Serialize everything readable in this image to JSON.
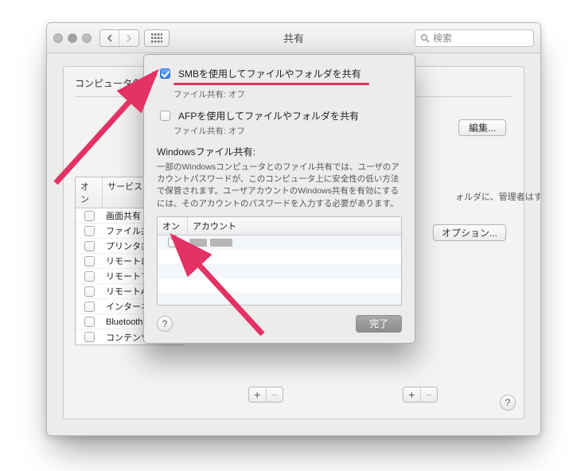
{
  "window": {
    "title": "共有",
    "search_placeholder": "検索"
  },
  "main": {
    "computer_name_label": "コンピュータ名",
    "edit_button": "編集...",
    "option_button": "オプション...",
    "right_caption": "ォルダに、管理者はす",
    "services_header_on": "オン",
    "services_header_name": "サービス",
    "services": [
      {
        "on": false,
        "label": "画面共有"
      },
      {
        "on": false,
        "label": "ファイル共有"
      },
      {
        "on": false,
        "label": "プリンタ共"
      },
      {
        "on": false,
        "label": "リモートログ"
      },
      {
        "on": false,
        "label": "リモートマネ"
      },
      {
        "on": false,
        "label": "リモートApp"
      },
      {
        "on": false,
        "label": "インターネッ"
      },
      {
        "on": false,
        "label": "Bluetooth共"
      },
      {
        "on": false,
        "label": "コンテンツキ"
      }
    ]
  },
  "sheet": {
    "smb_label": "SMBを使用してファイルやフォルダを共有",
    "smb_sub": "ファイル共有: オフ",
    "afp_label": "AFPを使用してファイルやフォルダを共有",
    "afp_sub": "ファイル共有: オフ",
    "win_title": "Windowsファイル共有:",
    "win_desc": "一部のWindowsコンピュータとのファイル共有では、ユーザのアカウントパスワードが、このコンピュータ上に安全性の低い方法で保管されます。ユーザアカウントのWindows共有を有効にするには、そのアカウントのパスワードを入力する必要があります。",
    "acct_header_on": "オン",
    "acct_header_name": "アカウント",
    "done": "完了"
  }
}
